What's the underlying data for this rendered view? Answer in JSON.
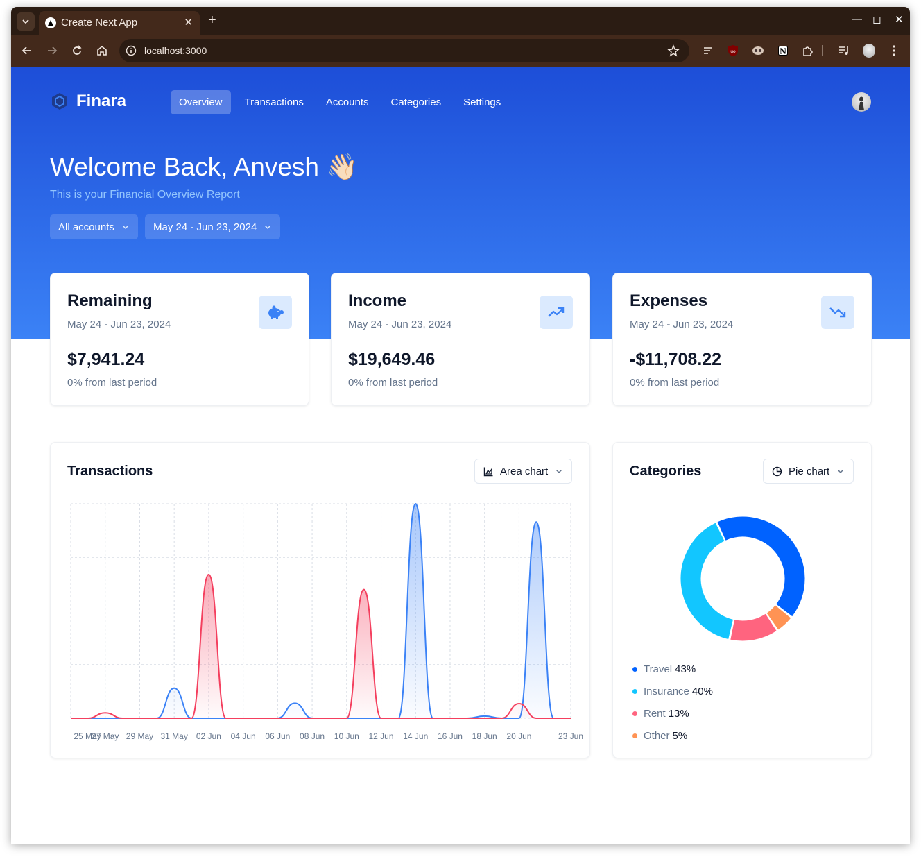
{
  "browser": {
    "tab_title": "Create Next App",
    "url": "localhost:3000"
  },
  "app": {
    "brand": "Finara",
    "nav": [
      "Overview",
      "Transactions",
      "Accounts",
      "Categories",
      "Settings"
    ],
    "active_nav": "Overview",
    "welcome": "Welcome Back, Anvesh 👋🏻",
    "subtitle": "This is your Financial Overview Report",
    "filters": {
      "account": "All accounts",
      "date_range": "May 24 - Jun 23, 2024"
    }
  },
  "stats": [
    {
      "title": "Remaining",
      "range": "May 24 - Jun 23, 2024",
      "value": "$7,941.24",
      "change": "0% from last period",
      "icon": "piggy-bank-icon"
    },
    {
      "title": "Income",
      "range": "May 24 - Jun 23, 2024",
      "value": "$19,649.46",
      "change": "0% from last period",
      "icon": "trending-up-icon"
    },
    {
      "title": "Expenses",
      "range": "May 24 - Jun 23, 2024",
      "value": "-$11,708.22",
      "change": "0% from last period",
      "icon": "trending-down-icon"
    }
  ],
  "transactions_panel": {
    "title": "Transactions",
    "chart_type_label": "Area chart"
  },
  "categories_panel": {
    "title": "Categories",
    "chart_type_label": "Pie chart"
  },
  "colors": {
    "income": "#3b82f6",
    "expenses": "#f43f5e",
    "travel": "#0062ff",
    "insurance": "#12c6ff",
    "rent": "#ff647f",
    "other": "#ff9354"
  },
  "chart_data": [
    {
      "type": "area",
      "title": "Transactions",
      "x": [
        "25 May",
        "26 May",
        "27 May",
        "28 May",
        "29 May",
        "30 May",
        "31 May",
        "01 Jun",
        "02 Jun",
        "03 Jun",
        "04 Jun",
        "05 Jun",
        "06 Jun",
        "07 Jun",
        "08 Jun",
        "09 Jun",
        "10 Jun",
        "11 Jun",
        "12 Jun",
        "13 Jun",
        "14 Jun",
        "15 Jun",
        "16 Jun",
        "17 Jun",
        "18 Jun",
        "19 Jun",
        "20 Jun",
        "21 Jun",
        "22 Jun",
        "23 Jun"
      ],
      "tick_labels": [
        "25 May",
        "27 May",
        "29 May",
        "31 May",
        "02 Jun",
        "04 Jun",
        "06 Jun",
        "08 Jun",
        "10 Jun",
        "12 Jun",
        "14 Jun",
        "16 Jun",
        "18 Jun",
        "20 Jun",
        "23 Jun"
      ],
      "series": [
        {
          "name": "income",
          "color": "#3b82f6",
          "values": [
            0,
            0,
            0,
            0,
            0,
            0,
            1400,
            0,
            0,
            0,
            0,
            0,
            0,
            700,
            0,
            0,
            0,
            0,
            0,
            0,
            10000,
            0,
            0,
            0,
            100,
            0,
            0,
            9150,
            0,
            0
          ]
        },
        {
          "name": "expenses",
          "color": "#f43f5e",
          "values": [
            0,
            0,
            250,
            0,
            0,
            0,
            0,
            0,
            6700,
            0,
            0,
            0,
            0,
            0,
            0,
            0,
            0,
            6000,
            0,
            0,
            0,
            0,
            0,
            0,
            0,
            0,
            680,
            0,
            0,
            0
          ]
        }
      ],
      "ylim": [
        0,
        10000
      ],
      "grid": true
    },
    {
      "type": "pie",
      "title": "Categories",
      "labels": [
        "Travel",
        "Insurance",
        "Rent",
        "Other"
      ],
      "values": [
        43,
        40,
        13,
        5
      ],
      "legend": [
        "Travel 43%",
        "Insurance 40%",
        "Rent 13%",
        "Other 5%"
      ],
      "donut": true
    }
  ]
}
